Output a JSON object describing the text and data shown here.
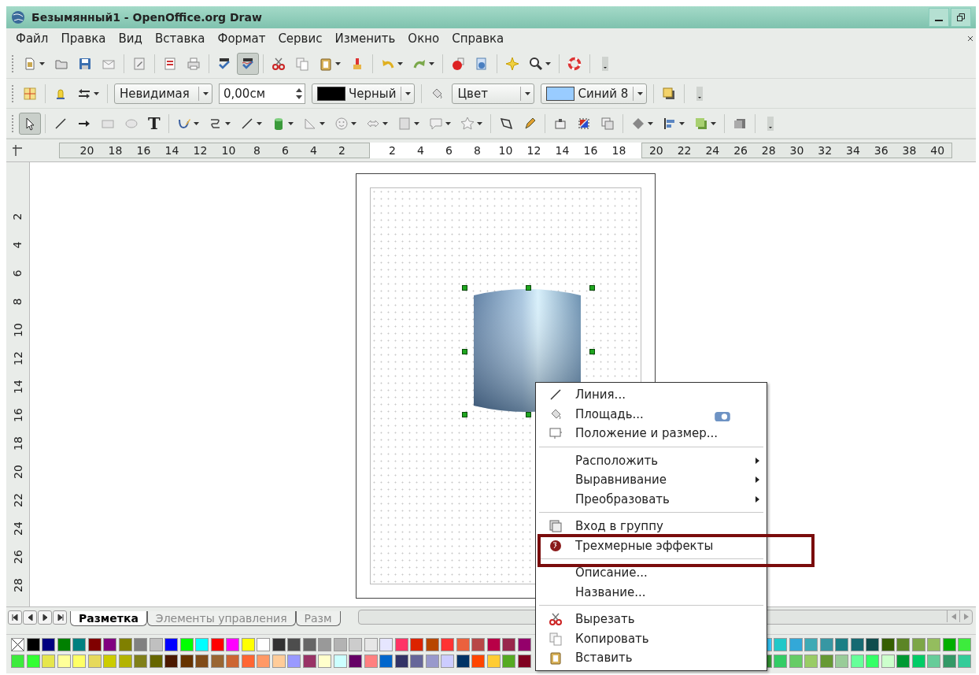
{
  "window": {
    "title": "Безымянный1 - OpenOffice.org Draw"
  },
  "menu_bar": [
    "Файл",
    "Правка",
    "Вид",
    "Вставка",
    "Формат",
    "Сервис",
    "Изменить",
    "Окно",
    "Справка"
  ],
  "toolbars": [
    {
      "groups": [
        [
          {
            "kind": "new",
            "caret": true,
            "pressed": false
          },
          {
            "kind": "open",
            "caret": false,
            "pressed": false
          },
          {
            "kind": "save",
            "caret": false,
            "pressed": false
          },
          {
            "kind": "email",
            "caret": false,
            "pressed": false
          }
        ],
        [
          {
            "kind": "edit",
            "caret": false,
            "pressed": false
          }
        ],
        [
          {
            "kind": "pdf",
            "caret": false,
            "pressed": false
          },
          {
            "kind": "print",
            "caret": false,
            "pressed": false
          }
        ],
        [
          {
            "kind": "spell",
            "caret": false,
            "pressed": false
          },
          {
            "kind": "autospell",
            "caret": false,
            "pressed": true
          }
        ],
        [
          {
            "kind": "cut",
            "caret": false,
            "pressed": false
          },
          {
            "kind": "copy",
            "caret": false,
            "pressed": false
          },
          {
            "kind": "paste",
            "caret": true,
            "pressed": false
          },
          {
            "kind": "brush",
            "caret": false,
            "pressed": false
          }
        ],
        [
          {
            "kind": "undo",
            "caret": true,
            "pressed": false
          },
          {
            "kind": "redo",
            "caret": true,
            "pressed": false
          }
        ],
        [
          {
            "kind": "ball",
            "caret": false,
            "pressed": false
          },
          {
            "kind": "navigator",
            "caret": false,
            "pressed": false
          }
        ],
        [
          {
            "kind": "sparkle",
            "caret": false,
            "pressed": false
          },
          {
            "kind": "zoom",
            "caret": true,
            "pressed": false
          }
        ],
        [
          {
            "kind": "help",
            "caret": false,
            "pressed": false
          }
        ],
        [
          {
            "kind": "overflow",
            "caret": false,
            "pressed": false
          }
        ]
      ]
    },
    {
      "groups": [
        [
          {
            "kind": "grid",
            "caret": false,
            "pressed": false
          }
        ],
        [
          {
            "kind": "bell",
            "caret": false,
            "pressed": false
          },
          {
            "kind": "arrows",
            "caret": true,
            "pressed": false
          }
        ],
        [
          {
            "kind": "combo",
            "value": "Невидимая"
          },
          {
            "kind": "spin",
            "value": "0,00см"
          },
          {
            "kind": "color-combo",
            "value": "Черный",
            "color": "#000000"
          }
        ],
        [
          {
            "kind": "bucket",
            "caret": false,
            "pressed": false
          },
          {
            "kind": "combo",
            "value": "Цвет"
          },
          {
            "kind": "color-combo",
            "value": "Синий 8",
            "color": "#99ccff"
          }
        ],
        [
          {
            "kind": "shadow",
            "caret": false,
            "pressed": false
          }
        ],
        [
          {
            "kind": "overflow",
            "caret": false,
            "pressed": false
          }
        ]
      ]
    },
    {
      "groups": [
        [
          {
            "kind": "select",
            "caret": false,
            "pressed": true
          }
        ],
        [
          {
            "kind": "line",
            "caret": false,
            "pressed": false
          },
          {
            "kind": "line-arrow",
            "caret": false,
            "pressed": false
          },
          {
            "kind": "rect",
            "caret": false,
            "pressed": false
          },
          {
            "kind": "ellipse",
            "caret": false,
            "pressed": false
          },
          {
            "kind": "text",
            "glyph": "T",
            "caret": false,
            "pressed": false
          }
        ],
        [
          {
            "kind": "curve",
            "caret": true,
            "pressed": false
          },
          {
            "kind": "connector",
            "caret": true,
            "pressed": false
          },
          {
            "kind": "line",
            "caret": true,
            "pressed": false
          },
          {
            "kind": "cylinder",
            "caret": true,
            "pressed": false
          },
          {
            "kind": "triangle",
            "caret": true,
            "pressed": false
          },
          {
            "kind": "smiley",
            "caret": true,
            "pressed": false
          },
          {
            "kind": "double-arrow",
            "caret": true,
            "pressed": false
          },
          {
            "kind": "flowchart",
            "caret": true,
            "pressed": false
          },
          {
            "kind": "callout",
            "caret": true,
            "pressed": false
          },
          {
            "kind": "star",
            "caret": true,
            "pressed": false
          }
        ],
        [
          {
            "kind": "points",
            "caret": false,
            "pressed": false
          },
          {
            "kind": "pencil",
            "caret": false,
            "pressed": false
          }
        ],
        [
          {
            "kind": "framed-box",
            "caret": false,
            "pressed": false
          },
          {
            "kind": "triangles",
            "caret": false,
            "pressed": false
          },
          {
            "kind": "stacked",
            "caret": false,
            "pressed": false
          }
        ],
        [
          {
            "kind": "diamond",
            "caret": true,
            "pressed": false
          },
          {
            "kind": "align",
            "caret": true,
            "pressed": false
          },
          {
            "kind": "layered",
            "caret": true,
            "pressed": false
          }
        ],
        [
          {
            "kind": "extrude",
            "caret": false,
            "pressed": false
          }
        ],
        [
          {
            "kind": "overflow",
            "caret": false,
            "pressed": false
          }
        ]
      ]
    }
  ],
  "horizontal_ruler": [
    {
      "kind": "margin",
      "labels": [
        "20",
        "18",
        "16",
        "14",
        "12",
        "10",
        "8",
        "6",
        "4",
        "2"
      ]
    },
    {
      "kind": "page",
      "labels": [
        "2",
        "4",
        "6",
        "8",
        "10",
        "12",
        "14",
        "16",
        "18"
      ]
    },
    {
      "kind": "margin",
      "labels": [
        "20",
        "22",
        "24",
        "26",
        "28",
        "30",
        "32",
        "34",
        "36",
        "38",
        "40"
      ]
    }
  ],
  "vertical_ruler": {
    "labels": [
      "2",
      "4",
      "6",
      "8",
      "10",
      "12",
      "14",
      "16",
      "18",
      "20",
      "22",
      "24",
      "26",
      "28"
    ]
  },
  "canvas": {
    "object_selected": true
  },
  "context_menu": [
    {
      "kind": "line",
      "label": "Линия...",
      "submenu": false,
      "highlighted": false,
      "trailing_icon": false
    },
    {
      "kind": "fill",
      "label": "Площадь...",
      "submenu": false,
      "highlighted": false,
      "trailing_icon": true
    },
    {
      "kind": "position",
      "label": "Положение и размер...",
      "submenu": false,
      "highlighted": false,
      "trailing_icon": false
    },
    {
      "kind": "separator"
    },
    {
      "kind": "plain",
      "label": "Расположить",
      "submenu": true,
      "highlighted": false,
      "trailing_icon": false
    },
    {
      "kind": "plain",
      "label": "Выравнивание",
      "submenu": true,
      "highlighted": false,
      "trailing_icon": false
    },
    {
      "kind": "plain",
      "label": "Преобразовать",
      "submenu": true,
      "highlighted": false,
      "trailing_icon": false
    },
    {
      "kind": "separator"
    },
    {
      "kind": "group",
      "label": "Вход в группу",
      "submenu": false,
      "highlighted": false,
      "trailing_icon": false
    },
    {
      "kind": "effects",
      "label": "Трехмерные эффекты",
      "submenu": false,
      "highlighted": true,
      "trailing_icon": false
    },
    {
      "kind": "separator"
    },
    {
      "kind": "plain",
      "label": "Описание...",
      "submenu": false,
      "highlighted": false,
      "trailing_icon": false
    },
    {
      "kind": "plain",
      "label": "Название...",
      "submenu": false,
      "highlighted": false,
      "trailing_icon": false
    },
    {
      "kind": "separator"
    },
    {
      "kind": "cut",
      "label": "Вырезать",
      "submenu": false,
      "highlighted": false,
      "trailing_icon": false
    },
    {
      "kind": "copy",
      "label": "Копировать",
      "submenu": false,
      "highlighted": false,
      "trailing_icon": false
    },
    {
      "kind": "paste",
      "label": "Вставить",
      "submenu": false,
      "highlighted": false,
      "trailing_icon": false
    }
  ],
  "page_tabs": [
    {
      "label": "Разметка",
      "selected": true
    },
    {
      "label": "Элементы управления",
      "selected": false
    },
    {
      "label": "Разм",
      "selected": false
    }
  ],
  "palette": {
    "no_fill_swatch": true,
    "rows": [
      {
        "left": [
          {
            "color": "#000000"
          },
          {
            "color": "#000080"
          },
          {
            "color": "#008000"
          },
          {
            "color": "#008080"
          },
          {
            "color": "#800000"
          },
          {
            "color": "#800080"
          },
          {
            "color": "#808000"
          },
          {
            "color": "#808080"
          },
          {
            "color": "#c0c0c0"
          },
          {
            "color": "#0000ff"
          },
          {
            "color": "#00ff00"
          },
          {
            "color": "#00ffff"
          },
          {
            "color": "#ff0000"
          },
          {
            "color": "#ff00ff"
          },
          {
            "color": "#ffff00"
          },
          {
            "color": "#ffffff"
          },
          {
            "color": "#333333"
          },
          {
            "color": "#4d4d4d"
          },
          {
            "color": "#666666"
          },
          {
            "color": "#999999"
          },
          {
            "color": "#b3b3b3"
          },
          {
            "color": "#cccccc"
          },
          {
            "color": "#e6e6e6"
          },
          {
            "color": "#e6e6ff"
          },
          {
            "color": "#ff3366"
          },
          {
            "color": "#dc2300"
          },
          {
            "color": "#b84700"
          },
          {
            "color": "#ff3333"
          },
          {
            "color": "#eb613d"
          },
          {
            "color": "#b84747"
          },
          {
            "color": "#b80047"
          },
          {
            "color": "#99284c"
          },
          {
            "color": "#94006b"
          }
        ],
        "right": [
          {
            "color": "#33ccff"
          },
          {
            "color": "#23c8c8"
          },
          {
            "color": "#33a8d8"
          },
          {
            "color": "#3eaab5"
          },
          {
            "color": "#3797a3"
          },
          {
            "color": "#1b7f85"
          },
          {
            "color": "#166a72"
          },
          {
            "color": "#0f4c4d"
          },
          {
            "color": "#355e00"
          },
          {
            "color": "#5c8526"
          },
          {
            "color": "#7da647"
          },
          {
            "color": "#94bd5e"
          },
          {
            "color": "#00ae00"
          },
          {
            "color": "#3deb3d"
          }
        ]
      },
      {
        "left": [
          {
            "color": "#3deb3d"
          },
          {
            "color": "#33ff33"
          },
          {
            "color": "#e6e64c"
          },
          {
            "color": "#ffff99"
          },
          {
            "color": "#ffff66"
          },
          {
            "color": "#e6d95c"
          },
          {
            "color": "#cccc00"
          },
          {
            "color": "#b3b300"
          },
          {
            "color": "#808019"
          },
          {
            "color": "#666600"
          },
          {
            "color": "#4c1900"
          },
          {
            "color": "#663300"
          },
          {
            "color": "#804c19"
          },
          {
            "color": "#996633"
          },
          {
            "color": "#cc6633"
          },
          {
            "color": "#ff6633"
          },
          {
            "color": "#ff9966"
          },
          {
            "color": "#ffcc99"
          },
          {
            "color": "#9999ff"
          },
          {
            "color": "#993366"
          },
          {
            "color": "#ffffcc"
          },
          {
            "color": "#ccffff"
          },
          {
            "color": "#660066"
          },
          {
            "color": "#ff8080"
          },
          {
            "color": "#0066cc"
          },
          {
            "color": "#333366"
          },
          {
            "color": "#666699"
          },
          {
            "color": "#9999cc"
          },
          {
            "color": "#ccccff"
          },
          {
            "color": "#003366"
          },
          {
            "color": "#ff4500"
          },
          {
            "color": "#ffcc33"
          },
          {
            "color": "#55aa22"
          },
          {
            "color": "#800020"
          }
        ],
        "right": [
          {
            "color": "#339933"
          },
          {
            "color": "#33cc66"
          },
          {
            "color": "#66cc66"
          },
          {
            "color": "#99cc66"
          },
          {
            "color": "#669933"
          },
          {
            "color": "#99cc99"
          },
          {
            "color": "#66ff99"
          },
          {
            "color": "#33ff66"
          },
          {
            "color": "#ccffcc"
          },
          {
            "color": "#009933"
          },
          {
            "color": "#00cc66"
          },
          {
            "color": "#66cc99"
          },
          {
            "color": "#339966"
          },
          {
            "color": "#33cc99"
          }
        ]
      }
    ]
  }
}
